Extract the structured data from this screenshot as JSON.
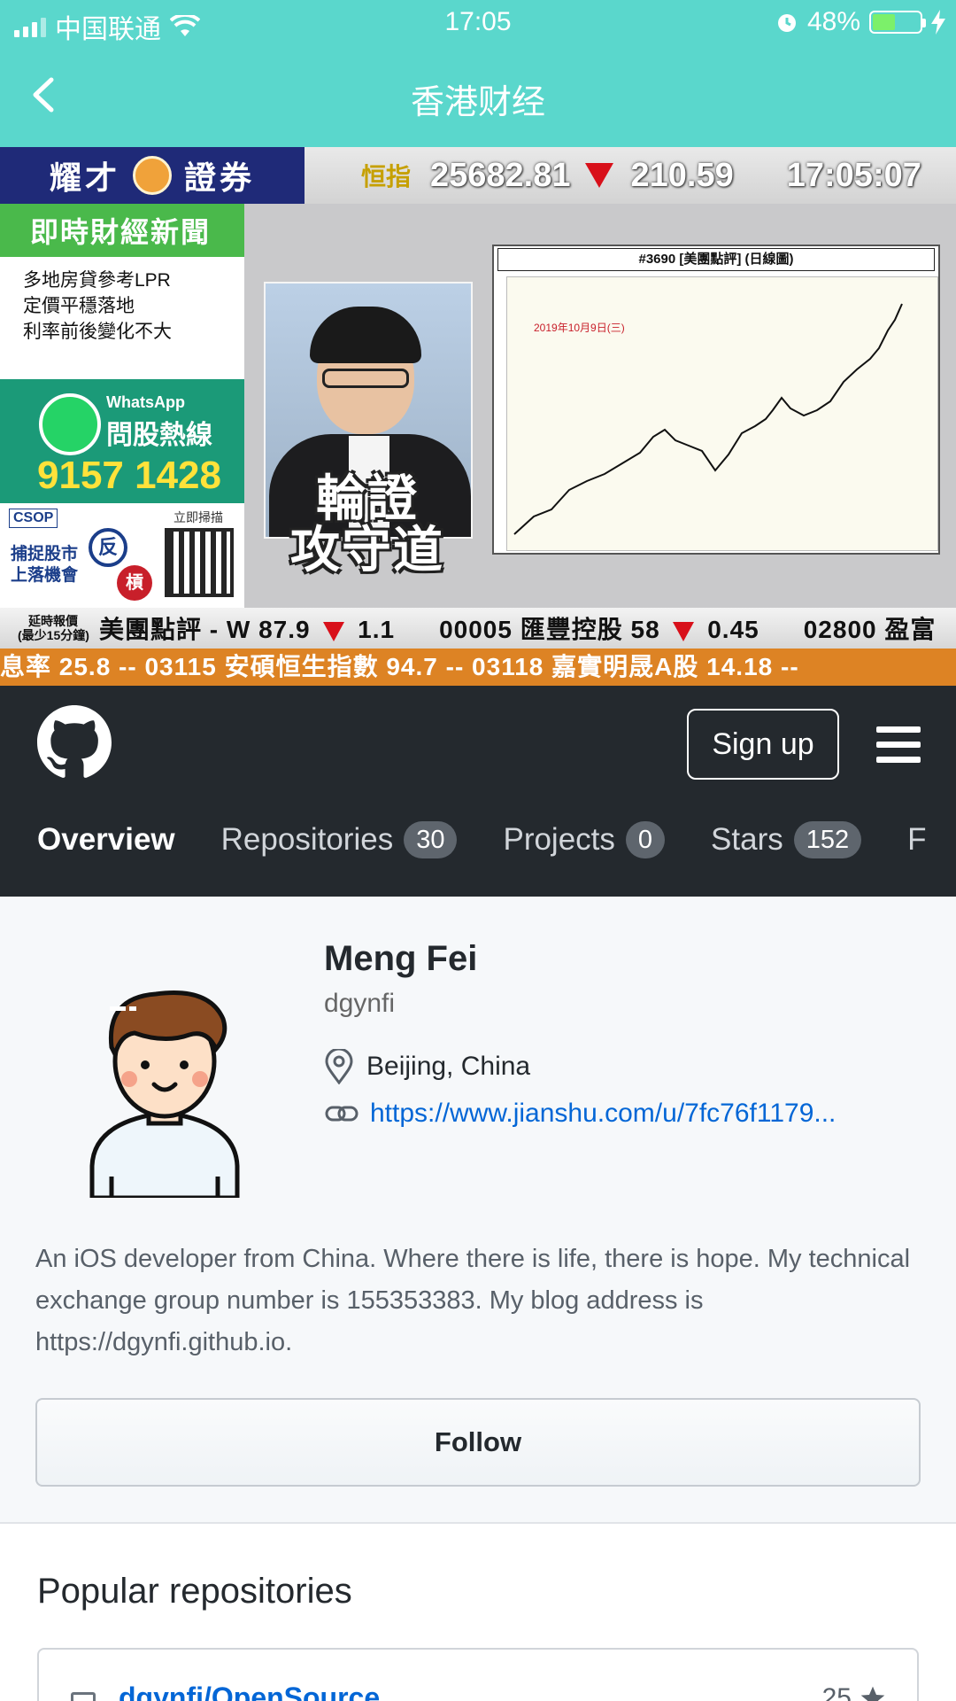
{
  "status_bar": {
    "carrier": "中国联通",
    "time": "17:05",
    "battery_percent": "48%",
    "battery_level": 0.48,
    "battery_color": "#7cf06a"
  },
  "nav": {
    "title": "香港财经",
    "back_icon": "chevron-left-icon",
    "bar_color": "#5ad7cc"
  },
  "video": {
    "brand": "耀才",
    "brand2": "證券",
    "index_label": "恒指",
    "index_value": "25682.81",
    "index_change": "210.59",
    "clock": "17:05:07",
    "news_header": "即時財經新聞",
    "news_lines": [
      "多地房貸參考LPR",
      "定價平穩落地",
      "利率前後變化不大"
    ],
    "whatsapp_title": "WhatsApp",
    "whatsapp_sub": "問股熱線",
    "whatsapp_phone": "9157 1428",
    "csop_logo": "CSOP",
    "csop_scan": "立即掃描",
    "csop_line1": "捕捉股市",
    "csop_line2": "上落機會",
    "csop_badge1": "反",
    "csop_badge2": "槓",
    "show_title_line1": "輪證",
    "show_title_line2": "攻守道",
    "chart_title": "#3690 [美團點評] (日線圖)",
    "chart_date": "2019年10月9日(三)",
    "ticker_delay_1": "延時報價",
    "ticker_delay_2": "(最少15分鐘)",
    "ticker_item1_name": "美團點評 - W 87.9",
    "ticker_item1_change": "1.1",
    "ticker_item2_name": "00005 匯豐控股 58",
    "ticker_item2_change": "0.45",
    "ticker_item3_name": "02800 盈富",
    "ticker2_text": "息率 25.8  --    03115 安碩恒生指數 94.7  --    03118 嘉實明晟A股 14.18  --"
  },
  "github": {
    "signup_label": "Sign up",
    "tabs": [
      {
        "label": "Overview",
        "count": ""
      },
      {
        "label": "Repositories",
        "count": "30"
      },
      {
        "label": "Projects",
        "count": "0"
      },
      {
        "label": "Stars",
        "count": "152"
      },
      {
        "label": "F",
        "count": ""
      }
    ]
  },
  "profile": {
    "name": "Meng Fei",
    "login": "dgynfi",
    "location": "Beijing, China",
    "url": "https://www.jianshu.com/u/7fc76f1179...",
    "bio": "An iOS developer from China. Where there is life, there is hope. My technical exchange group number is 155353383. My blog address is https://dgynfi.github.io.",
    "follow_label": "Follow"
  },
  "popular": {
    "title": "Popular repositories",
    "repos": [
      {
        "name": "dgynfi/OpenSource",
        "stars": "25"
      }
    ]
  }
}
